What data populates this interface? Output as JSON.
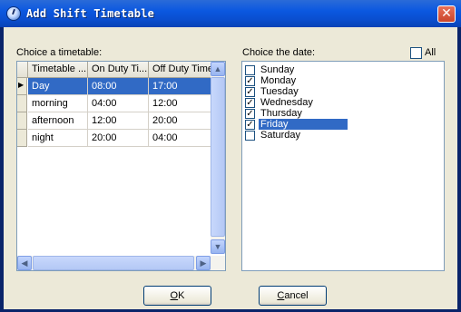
{
  "window": {
    "title": "Add Shift Timetable",
    "close_glyph": "✕"
  },
  "timetable": {
    "label": "Choice a timetable:",
    "columns": [
      "Timetable ...",
      "On Duty Ti...",
      "Off Duty Time"
    ],
    "rows": [
      {
        "name": "Day",
        "on": "08:00",
        "off": "17:00",
        "selected": true
      },
      {
        "name": "morning",
        "on": "04:00",
        "off": "12:00",
        "selected": false
      },
      {
        "name": "afternoon",
        "on": "12:00",
        "off": "20:00",
        "selected": false
      },
      {
        "name": "night",
        "on": "20:00",
        "off": "04:00",
        "selected": false
      }
    ],
    "current_row_glyph": "▶",
    "scroll": {
      "up": "▲",
      "down": "▼",
      "left": "◀",
      "right": "▶"
    }
  },
  "dates": {
    "label": "Choice the date:",
    "all_label": "All",
    "all_checked": false,
    "items": [
      {
        "label": "Sunday",
        "checked": false,
        "highlighted": false
      },
      {
        "label": "Monday",
        "checked": true,
        "highlighted": false
      },
      {
        "label": "Tuesday",
        "checked": true,
        "highlighted": false
      },
      {
        "label": "Wednesday",
        "checked": true,
        "highlighted": false
      },
      {
        "label": "Thursday",
        "checked": true,
        "highlighted": false
      },
      {
        "label": "Friday",
        "checked": true,
        "highlighted": true
      },
      {
        "label": "Saturday",
        "checked": false,
        "highlighted": false
      }
    ],
    "check_glyph": "✓"
  },
  "buttons": {
    "ok": {
      "accel": "O",
      "rest": "K"
    },
    "cancel": {
      "accel": "C",
      "rest": "ancel"
    }
  }
}
